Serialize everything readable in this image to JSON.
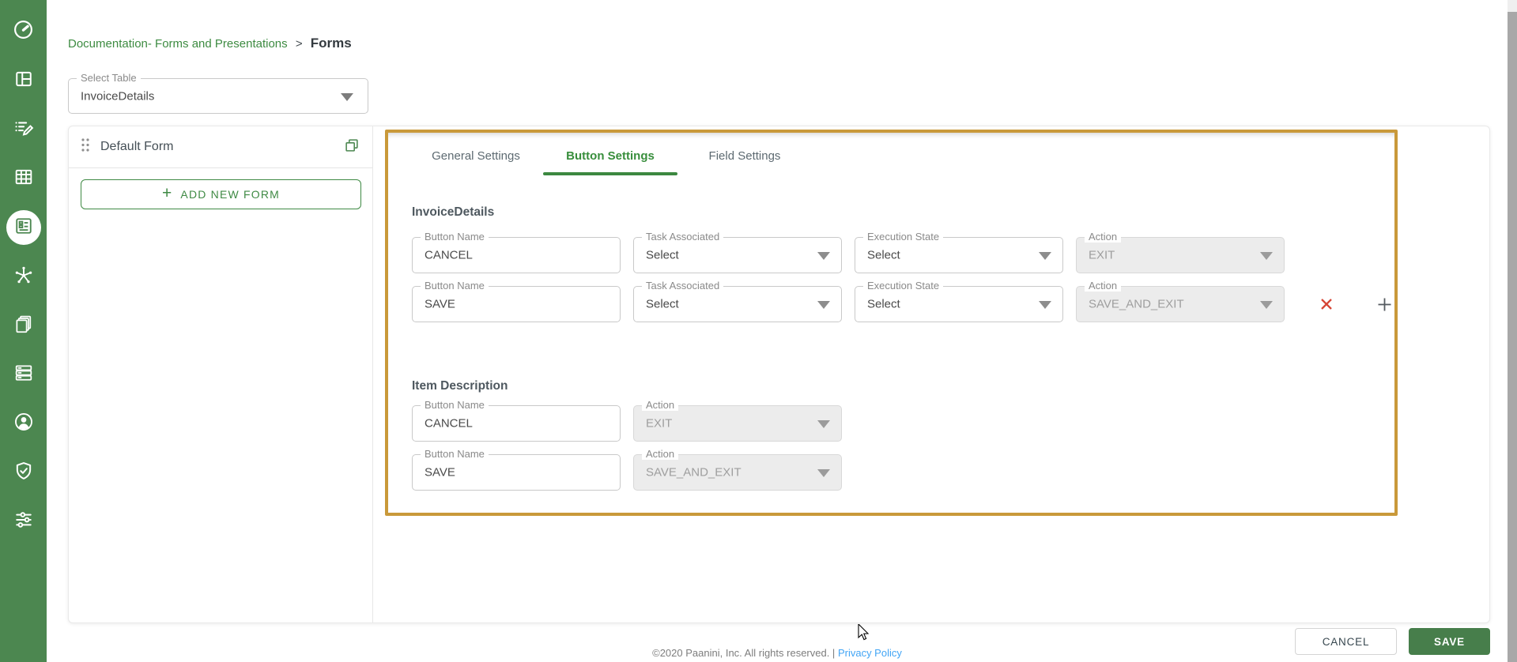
{
  "colors": {
    "sidebar_green": "#4c8750",
    "accent_green": "#3c8840",
    "breadcrumb_link_green": "#3d8b41",
    "panel_highlight_border": "#c9993a",
    "save_button_green": "#477e4b",
    "privacy_link_blue": "#42a5f5",
    "delete_red": "#d64535",
    "disabled_field_bg": "#ececec"
  },
  "icons": {
    "sidebar": [
      "dashboard-gauge-icon",
      "layout-icon",
      "form-edit-icon",
      "data-table-icon",
      "forms-icon",
      "network-hub-icon",
      "documents-icon",
      "servers-icon",
      "user-icon",
      "shield-check-icon",
      "settings-sliders-icon"
    ],
    "other": [
      "drag-handle-icon",
      "copy-icon",
      "dropdown-arrow-icon",
      "plus-icon",
      "delete-x-icon",
      "add-row-plus-icon",
      "mouse-cursor"
    ]
  },
  "breadcrumb": {
    "parent": "Documentation- Forms and Presentations",
    "separator": ">",
    "current": "Forms"
  },
  "table_select": {
    "label": "Select Table",
    "value": "InvoiceDetails"
  },
  "form_list": {
    "title": "Default Form",
    "add_new": "ADD NEW FORM"
  },
  "tabs": {
    "general": "General Settings",
    "button": "Button Settings",
    "field": "Field Settings",
    "active": "Button Settings"
  },
  "button_settings": {
    "sections": [
      {
        "title": "InvoiceDetails",
        "rows": [
          {
            "button_name": {
              "label": "Button Name",
              "value": "CANCEL"
            },
            "task_associated": {
              "label": "Task Associated",
              "value": "Select"
            },
            "execution_state": {
              "label": "Execution State",
              "value": "Select"
            },
            "action": {
              "label": "Action",
              "value": "EXIT",
              "disabled": true
            }
          },
          {
            "button_name": {
              "label": "Button Name",
              "value": "SAVE"
            },
            "task_associated": {
              "label": "Task Associated",
              "value": "Select"
            },
            "execution_state": {
              "label": "Execution State",
              "value": "Select"
            },
            "action": {
              "label": "Action",
              "value": "SAVE_AND_EXIT",
              "disabled": true
            }
          }
        ]
      },
      {
        "title": "Item Description",
        "rows": [
          {
            "button_name": {
              "label": "Button Name",
              "value": "CANCEL"
            },
            "action": {
              "label": "Action",
              "value": "EXIT",
              "disabled": true
            }
          },
          {
            "button_name": {
              "label": "Button Name",
              "value": "SAVE"
            },
            "action": {
              "label": "Action",
              "value": "SAVE_AND_EXIT",
              "disabled": true
            }
          }
        ]
      }
    ]
  },
  "footer": {
    "cancel": "CANCEL",
    "save": "SAVE",
    "copyright": "©2020 Paanini, Inc. All rights reserved. |",
    "privacy_policy": "Privacy Policy"
  }
}
